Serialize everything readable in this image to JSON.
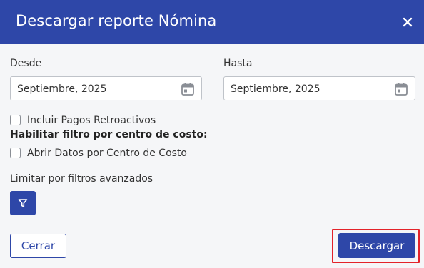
{
  "dialog": {
    "title": "Descargar reporte Nómina",
    "close_icon": "close-icon"
  },
  "from": {
    "label": "Desde",
    "value": "Septiembre, 2025",
    "icon": "calendar-icon"
  },
  "to": {
    "label": "Hasta",
    "value": "Septiembre, 2025",
    "icon": "calendar-icon"
  },
  "options": {
    "retro_label": "Incluir Pagos Retroactivos",
    "retro_checked": false,
    "cost_center_heading": "Habilitar filtro por centro de costo:",
    "cost_center_label": "Abrir Datos por Centro de Costo",
    "cost_center_checked": false
  },
  "advanced": {
    "label": "Limitar por filtros avanzados",
    "icon": "filter-icon"
  },
  "footer": {
    "close_label": "Cerrar",
    "download_label": "Descargar"
  },
  "colors": {
    "primary": "#2e47a8",
    "highlight": "#e3232a",
    "background": "#f5f6f8"
  }
}
